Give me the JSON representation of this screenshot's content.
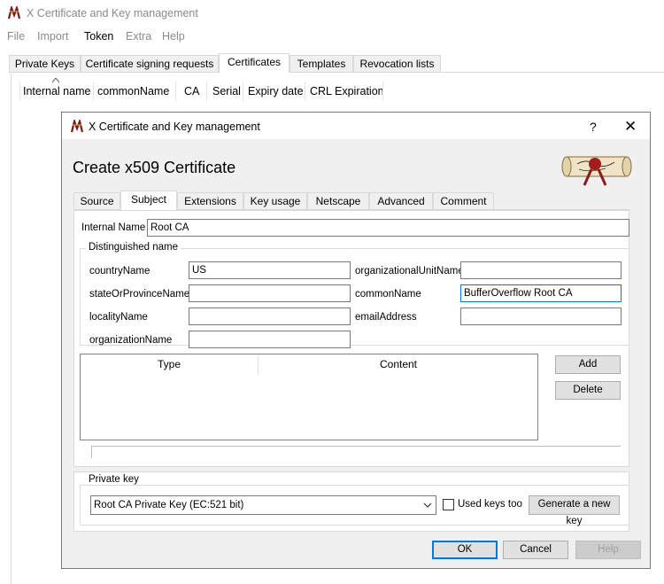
{
  "main_window": {
    "title": "X Certificate and Key management",
    "menu": [
      "File",
      "Import",
      "Token",
      "Extra",
      "Help"
    ],
    "tabs": [
      "Private Keys",
      "Certificate signing requests",
      "Certificates",
      "Templates",
      "Revocation lists"
    ],
    "selected_tab": "Certificates",
    "columns": [
      "Internal name",
      "commonName",
      "CA",
      "Serial",
      "Expiry date",
      "CRL Expiration"
    ]
  },
  "dialog": {
    "title": "X Certificate and Key management",
    "help_label": "?",
    "close_label": "✕",
    "heading": "Create x509 Certificate",
    "tabs": [
      "Source",
      "Subject",
      "Extensions",
      "Key usage",
      "Netscape",
      "Advanced",
      "Comment"
    ],
    "selected_tab": "Subject",
    "internal_name": {
      "label": "Internal Name",
      "value": "Root CA"
    },
    "dn_group_label": "Distinguished name",
    "fields": {
      "countryName": {
        "label": "countryName",
        "value": "US"
      },
      "stateOrProvinceName": {
        "label": "stateOrProvinceName",
        "value": ""
      },
      "localityName": {
        "label": "localityName",
        "value": ""
      },
      "organizationName": {
        "label": "organizationName",
        "value": ""
      },
      "organizationalUnitName": {
        "label": "organizationalUnitName",
        "value": ""
      },
      "commonName": {
        "label": "commonName",
        "value": "BufferOverflow Root CA"
      },
      "emailAddress": {
        "label": "emailAddress",
        "value": ""
      }
    },
    "table_headers": [
      "Type",
      "Content"
    ],
    "add_label": "Add",
    "delete_label": "Delete",
    "private_key_group_label": "Private key",
    "private_key_value": "Root CA Private Key (EC:521 bit)",
    "used_keys_label": "Used keys too",
    "used_keys_checked": false,
    "generate_label": "Generate a new key",
    "ok_label": "OK",
    "cancel_label": "Cancel",
    "help_button_label": "Help"
  }
}
